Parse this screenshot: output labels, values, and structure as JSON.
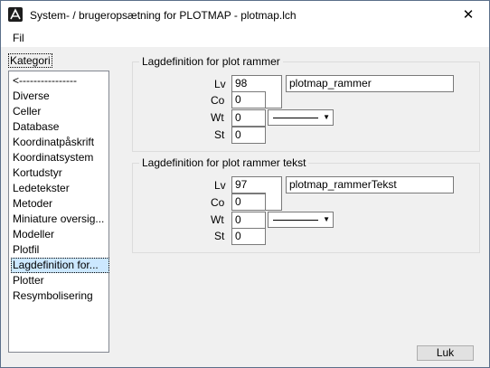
{
  "window": {
    "title": "System- / brugeropsætning for PLOTMAP - plotmap.lch",
    "close_glyph": "✕"
  },
  "menu": {
    "items": [
      {
        "label": "Fil"
      }
    ]
  },
  "sidebar": {
    "label": "Kategori",
    "items": [
      {
        "label": "<----------------"
      },
      {
        "label": "Diverse"
      },
      {
        "label": "Celler"
      },
      {
        "label": "Database"
      },
      {
        "label": "Koordinatpåskrift"
      },
      {
        "label": "Koordinatsystem"
      },
      {
        "label": "Kortudstyr"
      },
      {
        "label": "Ledetekster"
      },
      {
        "label": "Metoder"
      },
      {
        "label": "Miniature oversig..."
      },
      {
        "label": "Modeller"
      },
      {
        "label": "Plotfil"
      },
      {
        "label": "Lagdefinition for..."
      },
      {
        "label": "Plotter"
      },
      {
        "label": "Resymbolisering"
      }
    ],
    "selected_index": 12
  },
  "groups": [
    {
      "title": "Lagdefinition for plot rammer",
      "lv_label": "Lv",
      "lv_value": "98",
      "level_name": "plotmap_rammer",
      "co_label": "Co",
      "co_value": "0",
      "wt_label": "Wt",
      "wt_value": "0",
      "st_label": "St",
      "st_value": "0",
      "line_style_icon": "solid-line-dropdown-icon"
    },
    {
      "title": "Lagdefinition for plot rammer tekst",
      "lv_label": "Lv",
      "lv_value": "97",
      "level_name": "plotmap_rammerTekst",
      "co_label": "Co",
      "co_value": "0",
      "wt_label": "Wt",
      "wt_value": "0",
      "st_label": "St",
      "st_value": "0",
      "line_style_icon": "solid-line-dropdown-icon"
    }
  ],
  "footer": {
    "ok_label": "Luk"
  },
  "colors": {
    "selection": "#cce8ff",
    "titlebar": "#ffffff",
    "dialog": "#f0f0f0"
  }
}
